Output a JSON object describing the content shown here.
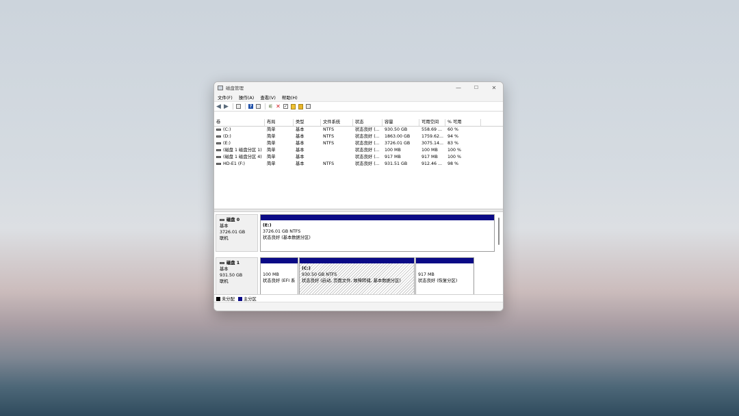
{
  "window": {
    "title": "磁盘管理"
  },
  "menu": [
    "文件(F)",
    "操作(A)",
    "查看(V)",
    "帮助(H)"
  ],
  "toolbar_icons": [
    "back-arrow-icon",
    "forward-arrow-icon",
    "disk-list-icon",
    "help-icon",
    "properties-icon",
    "connect-icon",
    "delete-icon",
    "check-icon",
    "new-volume-icon",
    "settings-icon",
    "view-icon"
  ],
  "volumes": {
    "columns": [
      "卷",
      "布局",
      "类型",
      "文件系统",
      "状态",
      "容量",
      "可用空间",
      "% 可用"
    ],
    "rows": [
      [
        "(C:)",
        "简单",
        "基本",
        "NTFS",
        "状态良好 (...",
        "930.50 GB",
        "558.69 ...",
        "60 %"
      ],
      [
        "(D:)",
        "简单",
        "基本",
        "NTFS",
        "状态良好 (...",
        "1863.00 GB",
        "1759.62...",
        "94 %"
      ],
      [
        "(E:)",
        "简单",
        "基本",
        "NTFS",
        "状态良好 (...",
        "3726.01 GB",
        "3075.14...",
        "83 %"
      ],
      [
        "(磁盘 1 磁盘分区 1)",
        "简单",
        "基本",
        "",
        "状态良好 (...",
        "100 MB",
        "100 MB",
        "100 %"
      ],
      [
        "(磁盘 1 磁盘分区 4)",
        "简单",
        "基本",
        "",
        "状态良好 (...",
        "917 MB",
        "917 MB",
        "100 %"
      ],
      [
        "HD-E1 (F:)",
        "简单",
        "基本",
        "NTFS",
        "状态良好 (...",
        "931.51 GB",
        "912.46 ...",
        "98 %"
      ]
    ]
  },
  "disks": [
    {
      "name": "磁盘 0",
      "type": "基本",
      "size": "3726.01 GB",
      "state": "联机",
      "partitions": [
        {
          "label": "(E:)",
          "size": "3726.01 GB NTFS",
          "status": "状态良好 (基本数据分区)"
        }
      ]
    },
    {
      "name": "磁盘 1",
      "type": "基本",
      "size": "931.50 GB",
      "state": "联机",
      "partitions": [
        {
          "label": "",
          "size": "100 MB",
          "status": "状态良好 (EFI 系"
        },
        {
          "label": "(C:)",
          "size": "930.50 GB NTFS",
          "status": "状态良好 (启动, 页面文件, 故障转储, 基本数据分区)"
        },
        {
          "label": "",
          "size": "917 MB",
          "status": "状态良好 (恢复分区)"
        }
      ]
    }
  ],
  "legend": [
    {
      "label": "未分配",
      "color": "#000000"
    },
    {
      "label": "主分区",
      "color": "#0a0a86"
    }
  ],
  "colors": {
    "primary_partition_bar": "#0a0a86",
    "delete_icon": "#d0141a"
  }
}
